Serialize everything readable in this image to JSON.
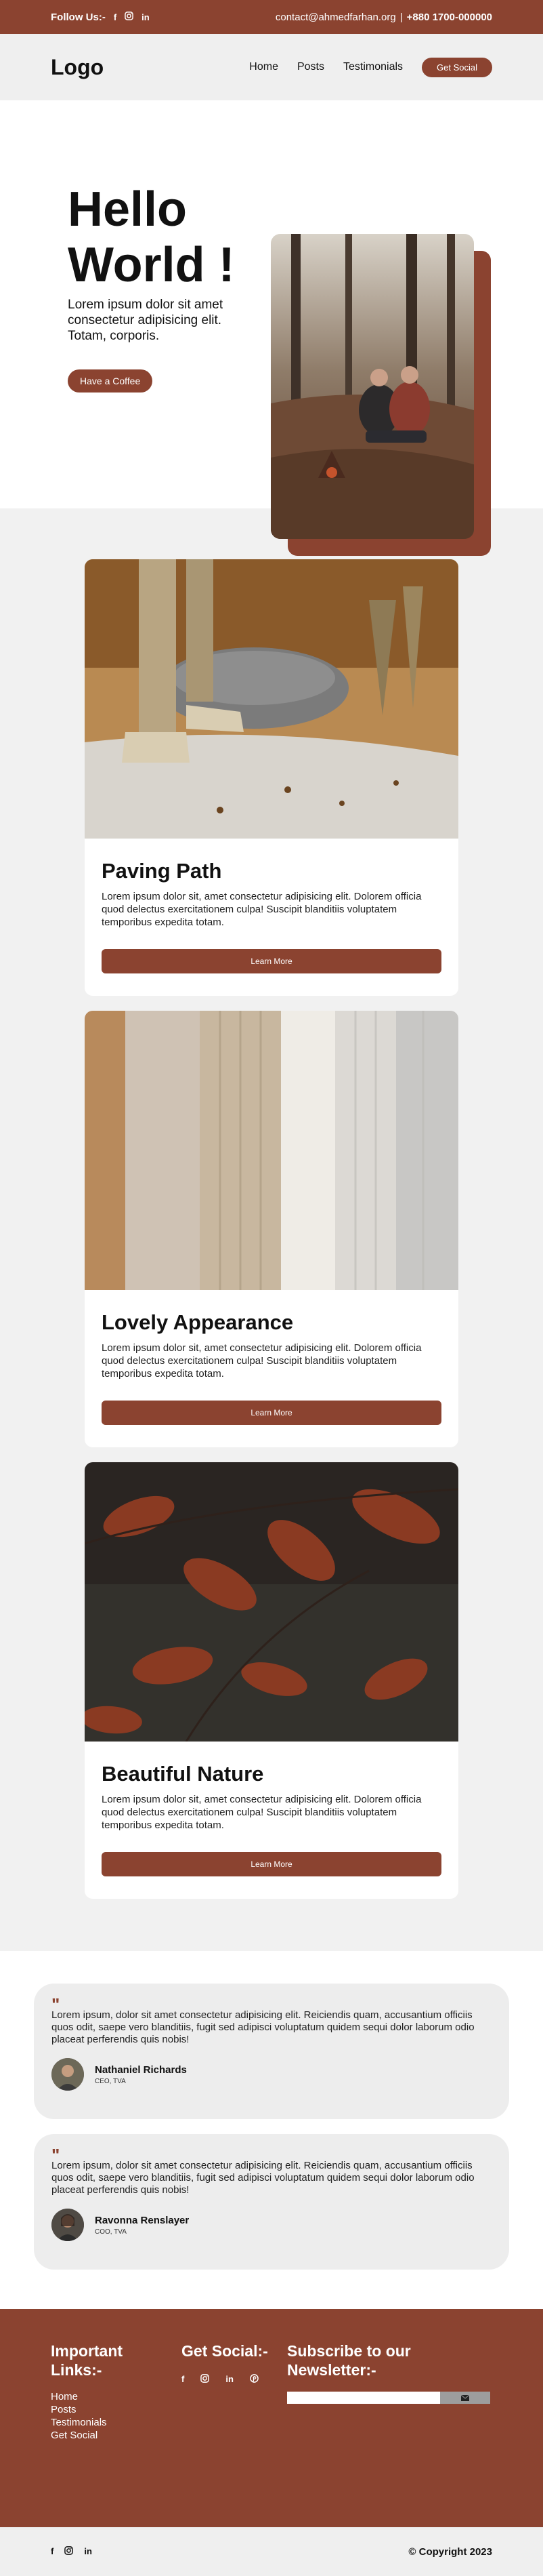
{
  "topbar": {
    "follow_label": "Follow Us:-",
    "social_icons": [
      "facebook-icon",
      "instagram-icon",
      "linkedin-icon"
    ],
    "email": "contact@ahmedfarhan.org",
    "separator": "|",
    "phone": "+880 1700-000000"
  },
  "navbar": {
    "logo": "Logo",
    "links": [
      "Home",
      "Posts",
      "Testimonials"
    ],
    "cta": "Get Social"
  },
  "hero": {
    "title_line1": "Hello",
    "title_line2": "World !",
    "description": "Lorem ipsum dolor sit amet consectetur adipisicing elit. Totam, corporis.",
    "button": "Have a Coffee"
  },
  "cards": [
    {
      "title": "Paving Path",
      "text": "Lorem ipsum dolor sit, amet consectetur adipisicing elit. Dolorem officia quod delectus exercitationem culpa! Suscipit blanditiis voluptatem temporibus expedita totam.",
      "button": "Learn More"
    },
    {
      "title": "Lovely Appearance",
      "text": "Lorem ipsum dolor sit, amet consectetur adipisicing elit. Dolorem officia quod delectus exercitationem culpa! Suscipit blanditiis voluptatem temporibus expedita totam.",
      "button": "Learn More"
    },
    {
      "title": "Beautiful Nature",
      "text": "Lorem ipsum dolor sit, amet consectetur adipisicing elit. Dolorem officia quod delectus exercitationem culpa! Suscipit blanditiis voluptatem temporibus expedita totam.",
      "button": "Learn More"
    }
  ],
  "testimonials": [
    {
      "quote_mark": "\"",
      "text": "Lorem ipsum, dolor sit amet consectetur adipisicing elit. Reiciendis quam, accusantium officiis quos odit, saepe vero blanditiis, fugit sed adipisci voluptatum quidem sequi dolor laborum odio placeat perferendis quis nobis!",
      "name": "Nathaniel Richards",
      "role": "CEO, TVA"
    },
    {
      "quote_mark": "\"",
      "text": "Lorem ipsum, dolor sit amet consectetur adipisicing elit. Reiciendis quam, accusantium officiis quos odit, saepe vero blanditiis, fugit sed adipisci voluptatum quidem sequi dolor laborum odio placeat perferendis quis nobis!",
      "name": "Ravonna Renslayer",
      "role": "COO, TVA"
    }
  ],
  "footer": {
    "links_title": "Important Links:-",
    "links": [
      "Home",
      "Posts",
      "Testimonials",
      "Get Social"
    ],
    "social_title": "Get Social:-",
    "social_icons": [
      "facebook-icon",
      "instagram-icon",
      "linkedin-icon",
      "pinterest-icon"
    ],
    "newsletter_title": "Subscribe to our Newsletter:-",
    "newsletter_placeholder": "",
    "send_icon": "envelope-icon"
  },
  "bottombar": {
    "icons": [
      "facebook-icon",
      "instagram-icon",
      "linkedin-icon"
    ],
    "copyright": "© Copyright 2023"
  },
  "colors": {
    "brand": "#8b4330",
    "page_bg": "#f1f1f1",
    "section_white": "#ffffff",
    "testimonial_bg": "#ededed"
  }
}
